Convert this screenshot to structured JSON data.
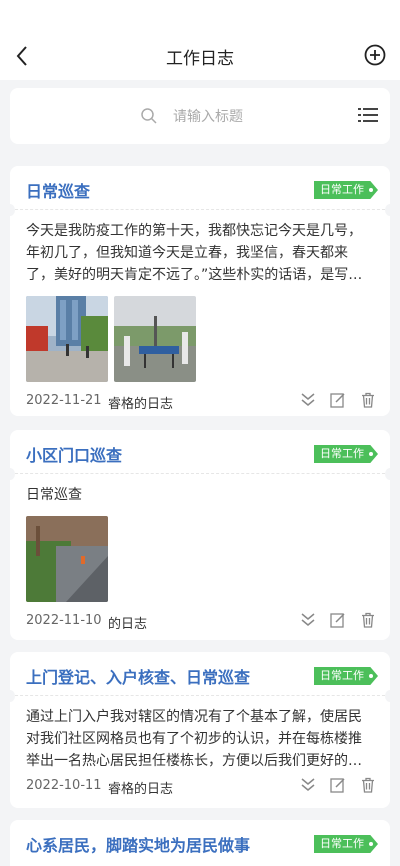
{
  "nav": {
    "title": "工作日志"
  },
  "search": {
    "placeholder": "请输入标题"
  },
  "logs": [
    {
      "title": "日常巡查",
      "tag": "日常工作",
      "content": "今天是我防疫工作的第十天，我都快忘记今天是几号，年初几了，但我知道今天是立春，我坚信，春天都来了，美好的明天肯定不远了。”这些朴实的话语，是写…",
      "date": "2022-11-21",
      "author": "睿格的日志"
    },
    {
      "title": "小区门口巡查",
      "tag": "日常工作",
      "content": "日常巡查",
      "date": "2022-11-10",
      "author": "的日志"
    },
    {
      "title": "上门登记、入户核查、日常巡查",
      "tag": "日常工作",
      "content": "通过上门入户我对辖区的情况有了个基本了解，使居民对我们社区网格员也有了个初步的认识，并在每栋楼推举出一名热心居民担任楼栋长，方便以后我们更好的…",
      "date": "2022-10-11",
      "author": "睿格的日志"
    },
    {
      "title": "心系居民，脚踏实地为居民做事",
      "tag": "日常工作"
    }
  ],
  "colors": {
    "accent": "#3b6fbf",
    "tag": "#4cbf5a",
    "background": "#f3f4f6"
  }
}
